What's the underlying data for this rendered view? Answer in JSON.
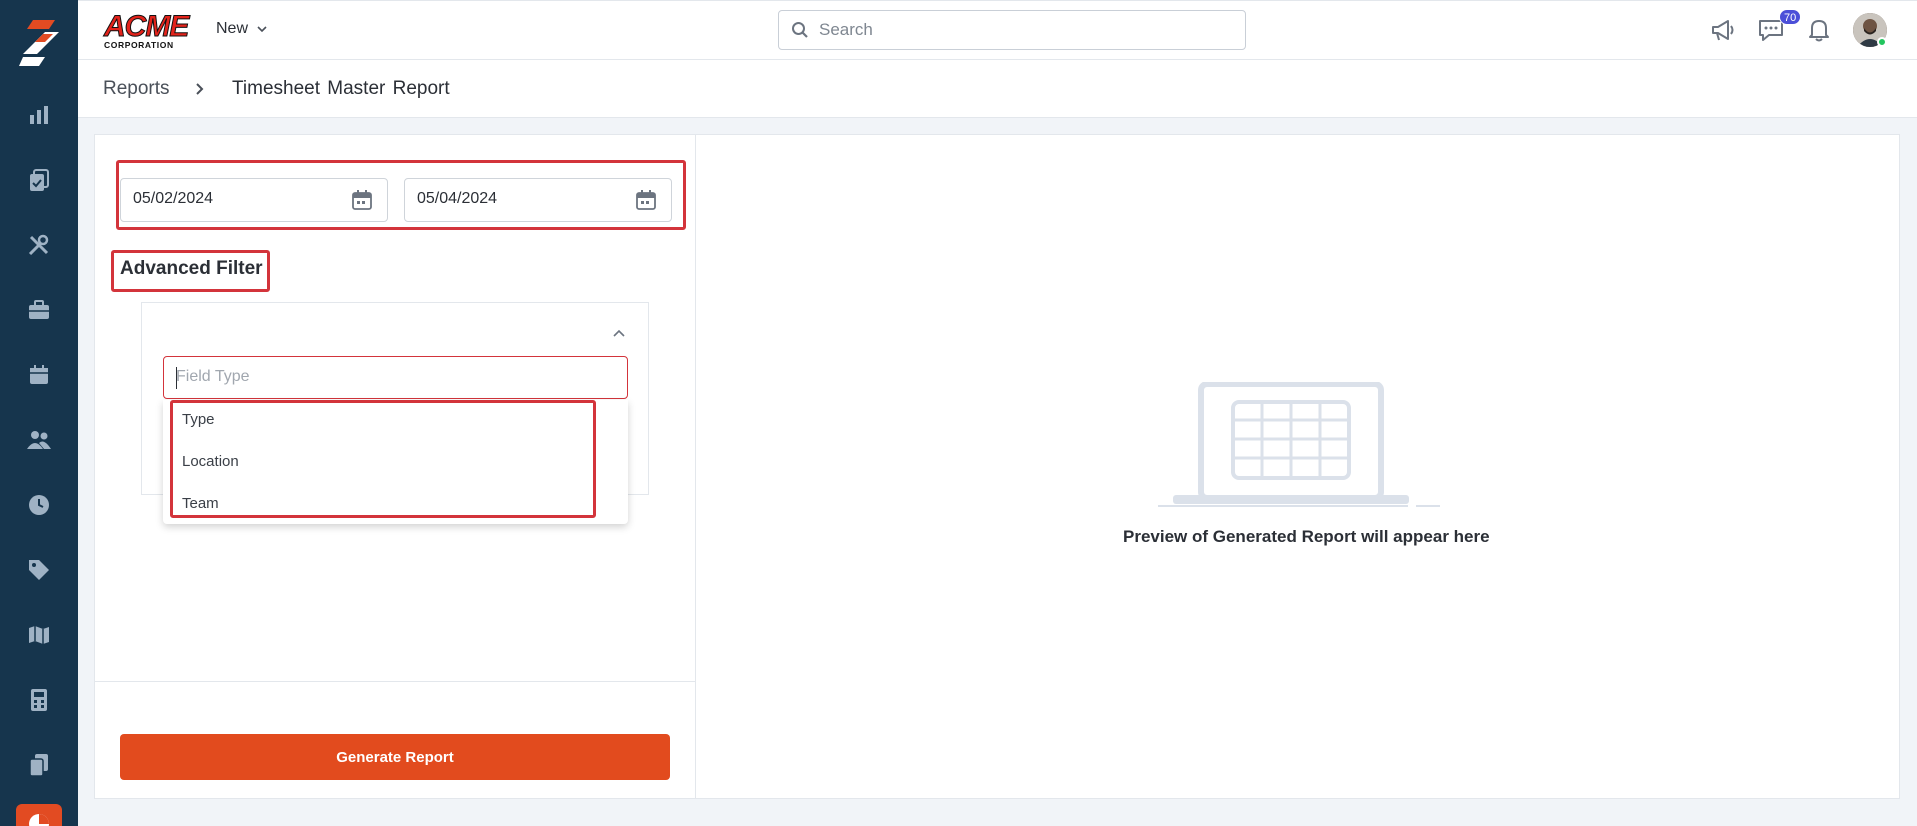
{
  "sidebar": {
    "items": [
      {
        "icon": "bar-chart-icon"
      },
      {
        "icon": "clipboard-check-icon"
      },
      {
        "icon": "tools-icon"
      },
      {
        "icon": "briefcase-icon"
      },
      {
        "icon": "calendar-icon"
      },
      {
        "icon": "users-icon"
      },
      {
        "icon": "clock-icon"
      },
      {
        "icon": "tag-icon"
      },
      {
        "icon": "map-icon"
      },
      {
        "icon": "calculator-icon"
      },
      {
        "icon": "documents-icon"
      },
      {
        "icon": "pie-chart-icon"
      }
    ],
    "colors": {
      "background": "#16354d",
      "active": "#e24b22"
    }
  },
  "header": {
    "brand_name": "ACME",
    "brand_sub": "CORPORATION",
    "new_label": "New",
    "search_placeholder": "Search",
    "notification_count": "70"
  },
  "breadcrumb": {
    "parent": "Reports",
    "current": "Timesheet Master Report"
  },
  "form": {
    "start_date": "05/02/2024",
    "end_date": "05/04/2024",
    "advanced_filter_label": "Advanced Filter",
    "field_type_placeholder": "Field Type",
    "field_type_options": [
      "Type",
      "Location",
      "Team"
    ],
    "generate_label": "Generate Report"
  },
  "preview": {
    "message": "Preview of Generated Report will appear here"
  },
  "colors": {
    "accent": "#e24b1e",
    "highlight": "#d3343b",
    "badge": "#4b4fd8"
  }
}
